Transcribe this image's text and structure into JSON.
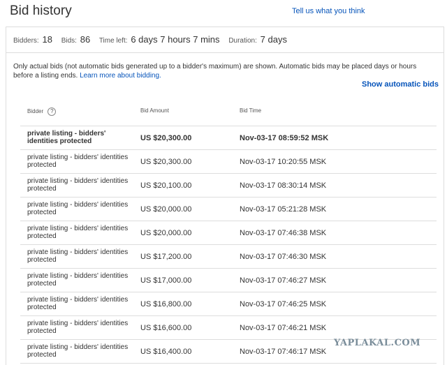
{
  "header": {
    "title": "Bid history",
    "feedback_link": "Tell us what you think"
  },
  "stats": {
    "bidders_label": "Bidders:",
    "bidders_value": "18",
    "bids_label": "Bids:",
    "bids_value": "86",
    "time_left_label": "Time left:",
    "time_left_value": "6 days 7 hours 7 mins",
    "duration_label": "Duration:",
    "duration_value": "7 days"
  },
  "notice": {
    "text": "Only actual bids (not automatic bids generated up to a bidder's maximum) are shown. Automatic bids may be placed days or hours before a listing ends.",
    "link": "Learn more about bidding."
  },
  "show_automatic_bids": "Show automatic bids",
  "table": {
    "headers": {
      "bidder": "Bidder",
      "amount": "Bid Amount",
      "time": "Bid Time"
    },
    "help_icon": "?",
    "rows": [
      {
        "bidder": "private listing - bidders' identities protected",
        "amount": "US $20,300.00",
        "time": "Nov-03-17 08:59:52 MSK"
      },
      {
        "bidder": "private listing - bidders' identities protected",
        "amount": "US $20,300.00",
        "time": "Nov-03-17 10:20:55 MSK"
      },
      {
        "bidder": "private listing - bidders' identities protected",
        "amount": "US $20,100.00",
        "time": "Nov-03-17 08:30:14 MSK"
      },
      {
        "bidder": "private listing - bidders' identities protected",
        "amount": "US $20,000.00",
        "time": "Nov-03-17 05:21:28 MSK"
      },
      {
        "bidder": "private listing - bidders' identities protected",
        "amount": "US $20,000.00",
        "time": "Nov-03-17 07:46:38 MSK"
      },
      {
        "bidder": "private listing - bidders' identities protected",
        "amount": "US $17,200.00",
        "time": "Nov-03-17 07:46:30 MSK"
      },
      {
        "bidder": "private listing - bidders' identities protected",
        "amount": "US $17,000.00",
        "time": "Nov-03-17 07:46:27 MSK"
      },
      {
        "bidder": "private listing - bidders' identities protected",
        "amount": "US $16,800.00",
        "time": "Nov-03-17 07:46:25 MSK"
      },
      {
        "bidder": "private listing - bidders' identities protected",
        "amount": "US $16,600.00",
        "time": "Nov-03-17 07:46:21 MSK"
      },
      {
        "bidder": "private listing - bidders' identities protected",
        "amount": "US $16,400.00",
        "time": "Nov-03-17 07:46:17 MSK"
      }
    ]
  },
  "watermark": "YAPLAKAL.COM"
}
